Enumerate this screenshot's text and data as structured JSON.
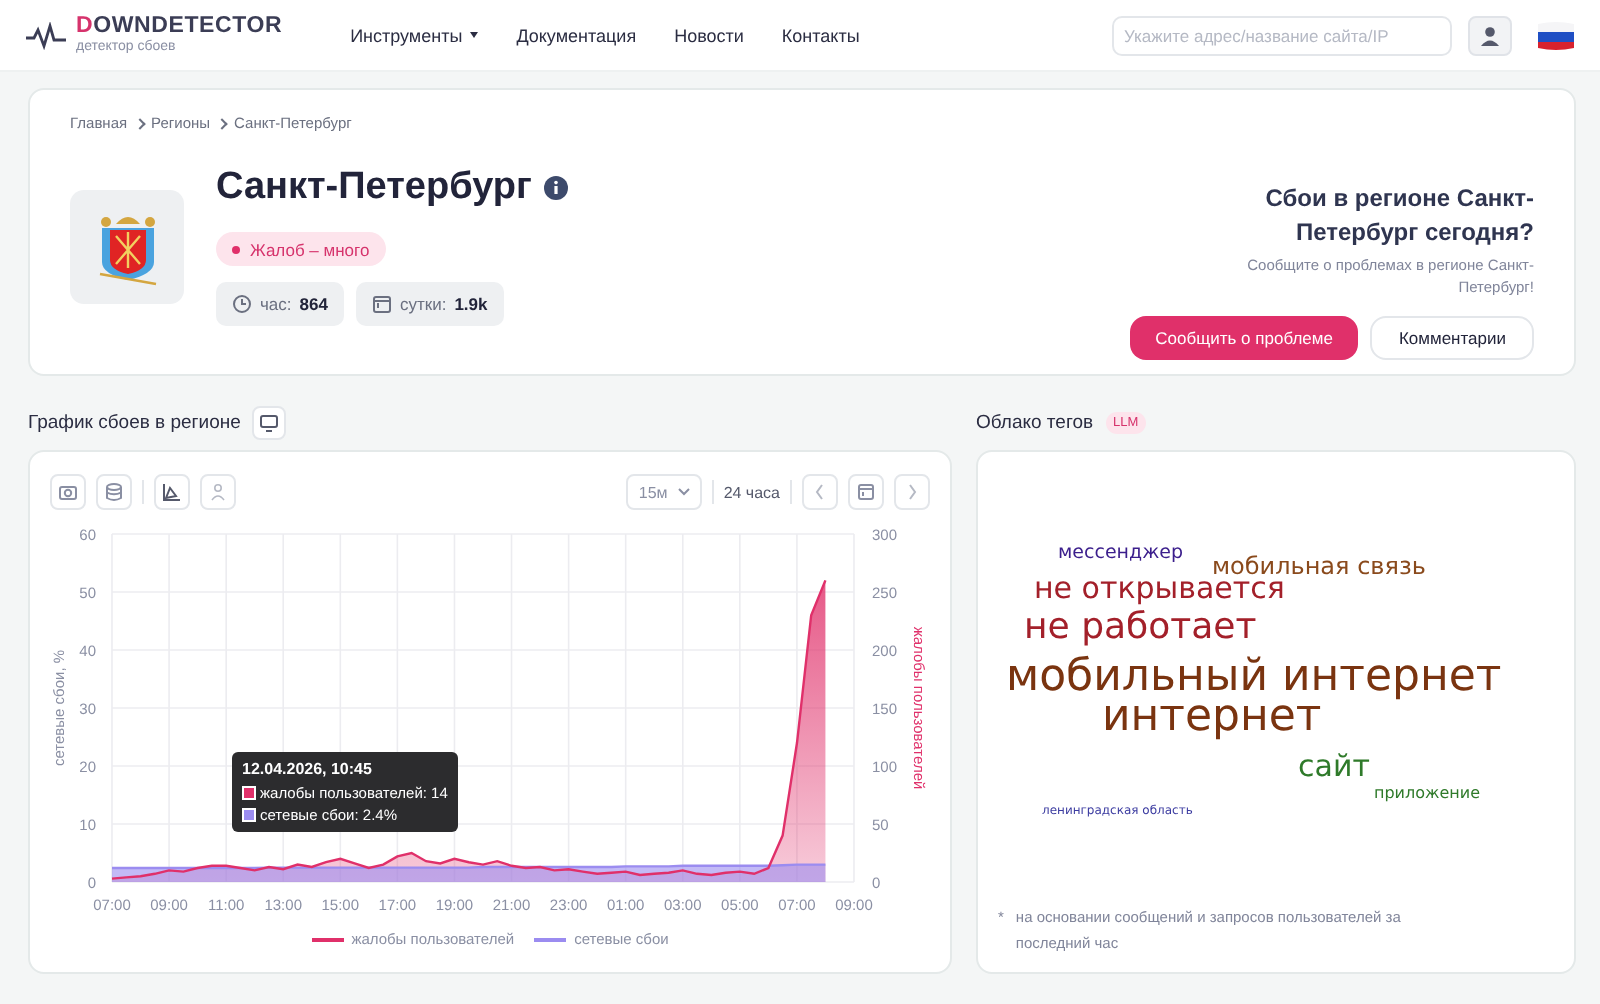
{
  "header": {
    "logo_title": "DOWNDETECTOR",
    "logo_subtitle": "детектор сбоев",
    "nav": [
      {
        "label": "Инструменты",
        "dropdown": true
      },
      {
        "label": "Документация",
        "dropdown": false
      },
      {
        "label": "Новости",
        "dropdown": false
      },
      {
        "label": "Контакты",
        "dropdown": false
      }
    ],
    "search": {
      "placeholder": "Укажите адрес/название сайта/IP"
    }
  },
  "breadcrumbs": [
    "Главная",
    "Регионы",
    "Санкт-Петербург"
  ],
  "region": {
    "title": "Санкт-Петербург",
    "status": "Жалоб – много",
    "stats": [
      {
        "kind": "hour",
        "label": "час:",
        "value": "864"
      },
      {
        "kind": "day",
        "label": "сутки:",
        "value": "1.9k"
      }
    ]
  },
  "report": {
    "heading": "Сбои в регионе Санкт-Петербург сегодня?",
    "text": "Сообщите о проблемах в регионе Санкт-Петербург!",
    "buttons": [
      {
        "label": "Сообщить о проблеме",
        "kind": "primary"
      },
      {
        "label": "Комментарии",
        "kind": "secondary"
      }
    ]
  },
  "outage_chart": {
    "title": "График сбоев в регионе",
    "interval": "15м",
    "period": "24 часа",
    "tooltip": {
      "title": "12.04.2026, 10:45",
      "items": [
        {
          "text": "жалобы пользователей: 14",
          "color": "#e0306a"
        },
        {
          "text": "сетевые сбои: 2.4%",
          "color": "#9b8cf0"
        }
      ]
    },
    "chart_data": {
      "type": "area",
      "grid": true,
      "ylabel": "сетевые сбои, %",
      "y2label": "жалобы пользователей",
      "ylim": [
        0,
        60
      ],
      "yticks": [
        0,
        10,
        20,
        30,
        40,
        50,
        60
      ],
      "y2lim": [
        0,
        300
      ],
      "y2ticks": [
        0,
        50,
        100,
        150,
        200,
        250,
        300
      ],
      "categories": [
        "07:00",
        null,
        null,
        null,
        "09:00",
        null,
        null,
        null,
        "11:00",
        null,
        null,
        null,
        "13:00",
        null,
        null,
        null,
        "15:00",
        null,
        null,
        null,
        "17:00",
        null,
        null,
        null,
        "19:00",
        null,
        null,
        null,
        "21:00",
        null,
        null,
        null,
        "23:00",
        null,
        null,
        null,
        "01:00",
        null,
        null,
        null,
        "03:00",
        null,
        null,
        null,
        "05:00",
        null,
        null,
        null,
        "07:00",
        null,
        null,
        null,
        "09:00"
      ],
      "series": [
        {
          "name": "жалобы пользователей",
          "color": "#e0306a",
          "axis": "y2",
          "values": [
            3,
            4,
            5,
            7,
            10,
            9,
            12,
            14,
            14,
            12,
            10,
            13,
            11,
            15,
            13,
            17,
            20,
            16,
            12,
            15,
            22,
            25,
            18,
            16,
            20,
            17,
            15,
            18,
            14,
            12,
            13,
            10,
            11,
            9,
            7,
            8,
            9,
            6,
            7,
            8,
            10,
            7,
            6,
            8,
            9,
            7,
            12,
            40,
            120,
            230,
            260,
            null,
            null
          ]
        },
        {
          "name": "сетевые сбои",
          "color": "#9b8cf0",
          "values": [
            2.4,
            2.4,
            2.4,
            2.4,
            2.4,
            2.4,
            2.4,
            2.4,
            2.4,
            2.4,
            2.4,
            2.5,
            2.5,
            2.5,
            2.5,
            2.5,
            2.5,
            2.5,
            2.5,
            2.5,
            2.5,
            2.5,
            2.5,
            2.5,
            2.5,
            2.5,
            2.6,
            2.6,
            2.6,
            2.6,
            2.6,
            2.6,
            2.6,
            2.6,
            2.6,
            2.6,
            2.7,
            2.7,
            2.7,
            2.7,
            2.8,
            2.8,
            2.8,
            2.8,
            2.8,
            2.8,
            2.8,
            2.9,
            3.0,
            3.0,
            3.0,
            null,
            null
          ]
        }
      ]
    }
  },
  "tag_cloud": {
    "title": "Облако тегов",
    "badge": "LLM",
    "tags": [
      {
        "text": "мессенджер",
        "kind": "s",
        "color": "#3b1e8c"
      },
      {
        "text": "мобильная связь",
        "kind": "m",
        "color": "#8a4a1c"
      },
      {
        "text": "не открывается",
        "kind": "l",
        "color": "#a3202a"
      },
      {
        "text": "не работает",
        "kind": "xl",
        "color": "#a3202a"
      },
      {
        "text": "мобильный интернет",
        "kind": "xxl",
        "color": "#7a3410"
      },
      {
        "text": "интернет",
        "kind": "xxl",
        "color": "#7a3410"
      },
      {
        "text": "сайт",
        "kind": "m2",
        "color": "#2f7a2a"
      },
      {
        "text": "приложение",
        "kind": "xs",
        "color": "#2f7a2a"
      },
      {
        "text": "ленинградская область",
        "kind": "xxs",
        "color": "#3b3ba0"
      }
    ],
    "footnote_mark": "*",
    "footnote": "на основании сообщений и запросов пользователей за последний час"
  }
}
